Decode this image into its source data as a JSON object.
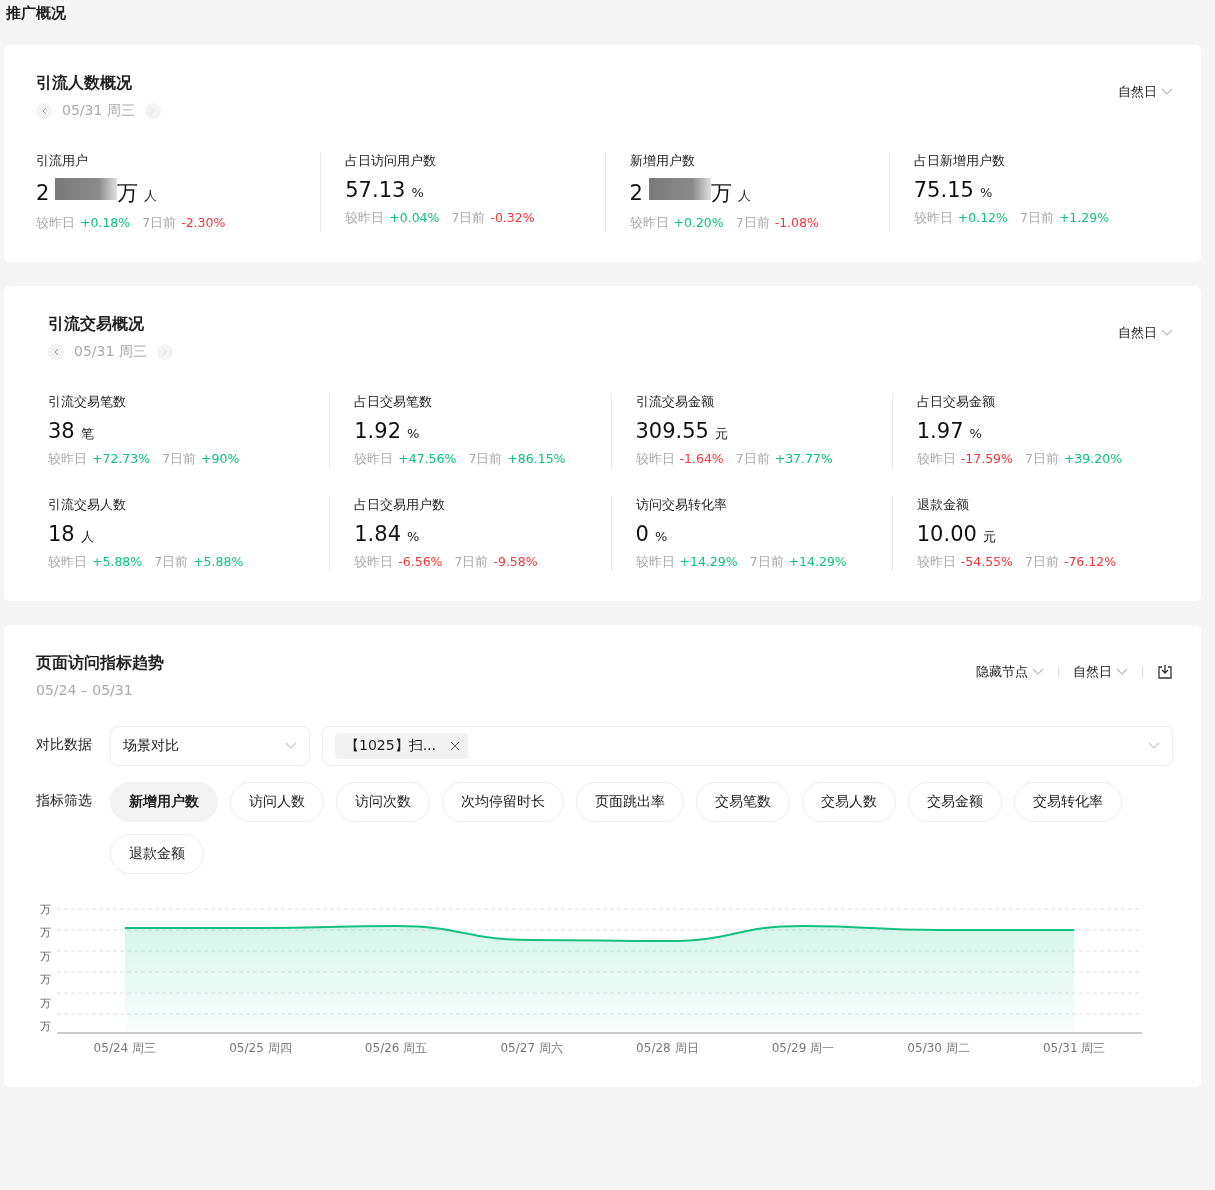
{
  "page_title": "推广概况",
  "sections": [
    {
      "title": "引流人数概况",
      "date": "05/31 周三",
      "period": "自然日",
      "metrics": [
        {
          "label": "引流用户",
          "value": "2",
          "value_tail": "万",
          "redacted": true,
          "unit": "人",
          "compare": [
            {
              "label": "较昨日",
              "value": "+0.18%",
              "color": "#0fc27a"
            },
            {
              "label": "7日前",
              "value": "-2.30%",
              "color": "#f5363a"
            }
          ]
        },
        {
          "label": "占日访问用户数",
          "value": "57.13",
          "redacted": false,
          "unit": "%",
          "compare": [
            {
              "label": "较昨日",
              "value": "+0.04%",
              "color": "#0fc27a"
            },
            {
              "label": "7日前",
              "value": "-0.32%",
              "color": "#f5363a"
            }
          ]
        },
        {
          "label": "新增用户数",
          "value": "2",
          "value_tail": "万",
          "redacted": true,
          "unit": "人",
          "compare": [
            {
              "label": "较昨日",
              "value": "+0.20%",
              "color": "#0fc27a"
            },
            {
              "label": "7日前",
              "value": "-1.08%",
              "color": "#f5363a"
            }
          ]
        },
        {
          "label": "占日新增用户数",
          "value": "75.15",
          "redacted": false,
          "unit": "%",
          "compare": [
            {
              "label": "较昨日",
              "value": "+0.12%",
              "color": "#0fc27a"
            },
            {
              "label": "7日前",
              "value": "+1.29%",
              "color": "#0fc27a"
            }
          ]
        }
      ]
    },
    {
      "title": "引流交易概况",
      "date": "05/31 周三",
      "period": "自然日",
      "metrics": [
        {
          "label": "引流交易笔数",
          "value": "38",
          "redacted": false,
          "unit": "笔",
          "compare": [
            {
              "label": "较昨日",
              "value": "+72.73%",
              "color": "#0fc27a"
            },
            {
              "label": "7日前",
              "value": "+90%",
              "color": "#0fc27a"
            }
          ]
        },
        {
          "label": "占日交易笔数",
          "value": "1.92",
          "redacted": false,
          "unit": "%",
          "compare": [
            {
              "label": "较昨日",
              "value": "+47.56%",
              "color": "#0fc27a"
            },
            {
              "label": "7日前",
              "value": "+86.15%",
              "color": "#0fc27a"
            }
          ]
        },
        {
          "label": "引流交易金额",
          "value": "309.55",
          "redacted": false,
          "unit": "元",
          "compare": [
            {
              "label": "较昨日",
              "value": "-1.64%",
              "color": "#f5363a"
            },
            {
              "label": "7日前",
              "value": "+37.77%",
              "color": "#0fc27a"
            }
          ]
        },
        {
          "label": "占日交易金额",
          "value": "1.97",
          "redacted": false,
          "unit": "%",
          "compare": [
            {
              "label": "较昨日",
              "value": "-17.59%",
              "color": "#f5363a"
            },
            {
              "label": "7日前",
              "value": "+39.20%",
              "color": "#0fc27a"
            }
          ]
        },
        {
          "label": "引流交易人数",
          "value": "18",
          "redacted": false,
          "unit": "人",
          "compare": [
            {
              "label": "较昨日",
              "value": "+5.88%",
              "color": "#0fc27a"
            },
            {
              "label": "7日前",
              "value": "+5.88%",
              "color": "#0fc27a"
            }
          ]
        },
        {
          "label": "占日交易用户数",
          "value": "1.84",
          "redacted": false,
          "unit": "%",
          "compare": [
            {
              "label": "较昨日",
              "value": "-6.56%",
              "color": "#f5363a"
            },
            {
              "label": "7日前",
              "value": "-9.58%",
              "color": "#f5363a"
            }
          ]
        },
        {
          "label": "访问交易转化率",
          "value": "0",
          "redacted": false,
          "unit": "%",
          "compare": [
            {
              "label": "较昨日",
              "value": "+14.29%",
              "color": "#0fc27a"
            },
            {
              "label": "7日前",
              "value": "+14.29%",
              "color": "#0fc27a"
            }
          ]
        },
        {
          "label": "退款金额",
          "value": "10.00",
          "redacted": false,
          "unit": "元",
          "compare": [
            {
              "label": "较昨日",
              "value": "-54.55%",
              "color": "#f5363a"
            },
            {
              "label": "7日前",
              "value": "-76.12%",
              "color": "#f5363a"
            }
          ]
        }
      ]
    }
  ],
  "trend": {
    "title": "页面访问指标趋势",
    "range": "05/24 – 05/31",
    "hide_nodes": "隐藏节点",
    "period": "自然日",
    "compare_label": "对比数据",
    "compare_select": "场景对比",
    "compare_tag": "【1025】扫...",
    "filter_label": "指标筛选",
    "filters": [
      {
        "label": "新增用户数",
        "selected": true
      },
      {
        "label": "访问人数",
        "selected": false
      },
      {
        "label": "访问次数",
        "selected": false
      },
      {
        "label": "次均停留时长",
        "selected": false
      },
      {
        "label": "页面跳出率",
        "selected": false
      },
      {
        "label": "交易笔数",
        "selected": false
      },
      {
        "label": "交易人数",
        "selected": false
      },
      {
        "label": "交易金额",
        "selected": false
      },
      {
        "label": "交易转化率",
        "selected": false
      },
      {
        "label": "退款金额",
        "selected": false
      }
    ],
    "y_labels": [
      "万",
      "万",
      "万",
      "万",
      "万",
      "万"
    ],
    "x_labels": [
      "05/24 周三",
      "05/25 周四",
      "05/26 周五",
      "05/27 周六",
      "05/28 周日",
      "05/29 周一",
      "05/30 周二",
      "05/31 周三"
    ]
  }
}
